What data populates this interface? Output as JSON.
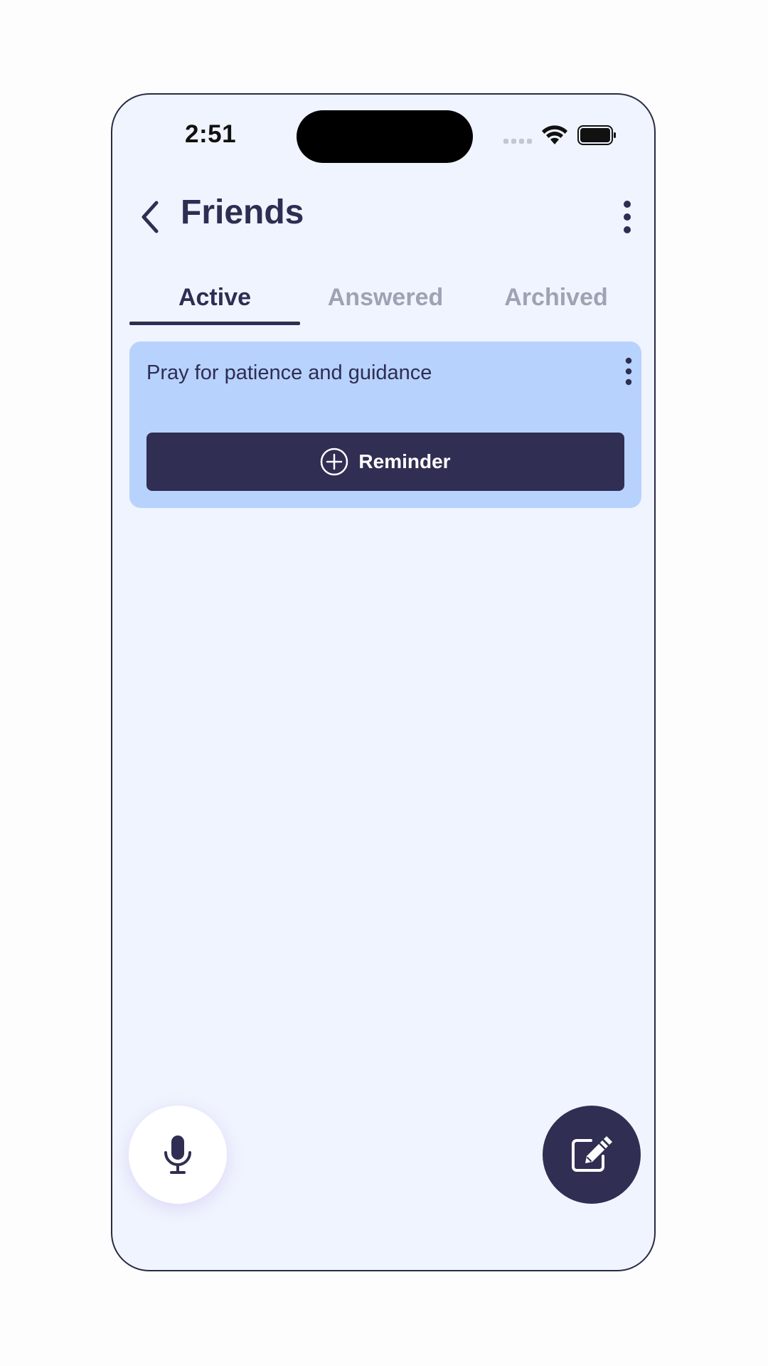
{
  "status_bar": {
    "time": "2:51",
    "icons": [
      "signal-icon",
      "wifi-icon",
      "battery-icon"
    ]
  },
  "header": {
    "title": "Friends",
    "back_icon": "chevron-left-icon",
    "menu_icon": "more-vertical-icon"
  },
  "tabs": [
    {
      "label": "Active",
      "selected": true
    },
    {
      "label": "Answered",
      "selected": false
    },
    {
      "label": "Archived",
      "selected": false
    }
  ],
  "prayers": [
    {
      "text": "Pray for patience and guidance",
      "button_label": "Reminder",
      "button_icon": "plus-circle-icon",
      "menu_icon": "more-vertical-icon"
    }
  ],
  "fabs": {
    "mic_icon": "microphone-icon",
    "edit_icon": "edit-note-icon"
  },
  "colors": {
    "primary": "#302e52",
    "background": "#f0f4fe",
    "card": "#b7d2fd",
    "inactive_tab": "#9ea2b3"
  }
}
